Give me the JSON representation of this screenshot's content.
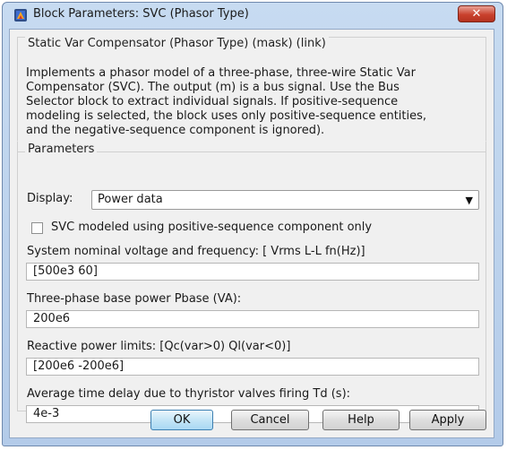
{
  "window": {
    "title": "Block Parameters: SVC (Phasor Type)",
    "close_glyph": "✕",
    "icon": "simulink-block-icon",
    "accent": "#c94a32"
  },
  "mask": {
    "group_title": "Static Var Compensator (Phasor Type) (mask) (link)",
    "description_lines": [
      "Implements a phasor model of a three-phase, three-wire Static Var",
      "Compensator (SVC). The output (m) is a bus signal. Use the Bus",
      "Selector block to extract individual signals. If positive-sequence",
      "modeling is selected, the block uses only positive-sequence entities,",
      "and the negative-sequence component is ignored)."
    ]
  },
  "parameters": {
    "group_title": "Parameters",
    "display_label": "Display:",
    "display_value": "Power data",
    "positive_sequence_label": "SVC modeled using positive-sequence component only",
    "positive_sequence_checked": false,
    "nominal_label": "System nominal voltage and frequency: [ Vrms L-L  fn(Hz)]",
    "nominal_value": "[500e3  60]",
    "base_power_label": "Three-phase base power Pbase (VA):",
    "base_power_value": "200e6",
    "reactive_label": "Reactive power limits: [Qc(var>0)  Ql(var<0)]",
    "reactive_value": "[200e6  -200e6]",
    "delay_label": "Average time delay due to thyristor valves firing Td (s):",
    "delay_value": "4e-3"
  },
  "buttons": {
    "ok": "OK",
    "cancel": "Cancel",
    "help": "Help",
    "apply": "Apply"
  }
}
